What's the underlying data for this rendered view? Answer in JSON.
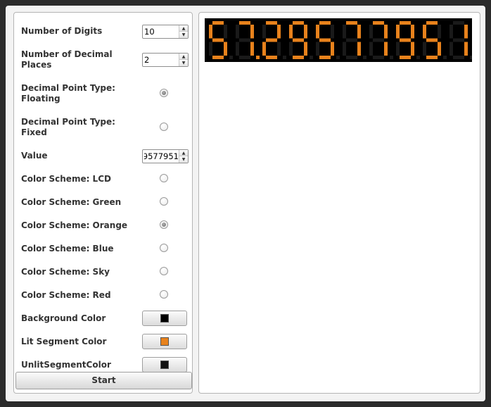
{
  "settings": {
    "num_digits_label": "Number of Digits",
    "num_digits_value": "10",
    "num_decimals_label_line1": "Number of Decimal",
    "num_decimals_label_line2": "Places",
    "num_decimals_value": "2",
    "dp_floating_label_line1": "Decimal Point Type:",
    "dp_floating_label_line2": "Floating",
    "dp_floating_checked": true,
    "dp_fixed_label_line1": "Decimal Point Type:",
    "dp_fixed_label_line2": "Fixed",
    "dp_fixed_checked": false,
    "value_label": "Value",
    "value_value": "9577951",
    "color_schemes": [
      {
        "label": "Color Scheme: LCD",
        "checked": false
      },
      {
        "label": "Color Scheme: Green",
        "checked": false
      },
      {
        "label": "Color Scheme: Orange",
        "checked": true
      },
      {
        "label": "Color Scheme: Blue",
        "checked": false
      },
      {
        "label": "Color Scheme: Sky",
        "checked": false
      },
      {
        "label": "Color Scheme: Red",
        "checked": false
      }
    ],
    "background_color_label": "Background Color",
    "background_color": "#000000",
    "lit_segment_label": "Lit Segment Color",
    "lit_segment_color": "#e8821c",
    "unlit_segment_label": "UnlitSegmentColor",
    "unlit_segment_color": "#111111",
    "start_label": "Start"
  },
  "display": {
    "digits": [
      "5",
      "7",
      "2",
      "9",
      "5",
      "7",
      "7",
      "9",
      "5",
      "1"
    ],
    "decimal_after_index": 1,
    "lit_color": "#e8821c",
    "unlit_color": "#1a1a1a",
    "background": "#000000"
  }
}
